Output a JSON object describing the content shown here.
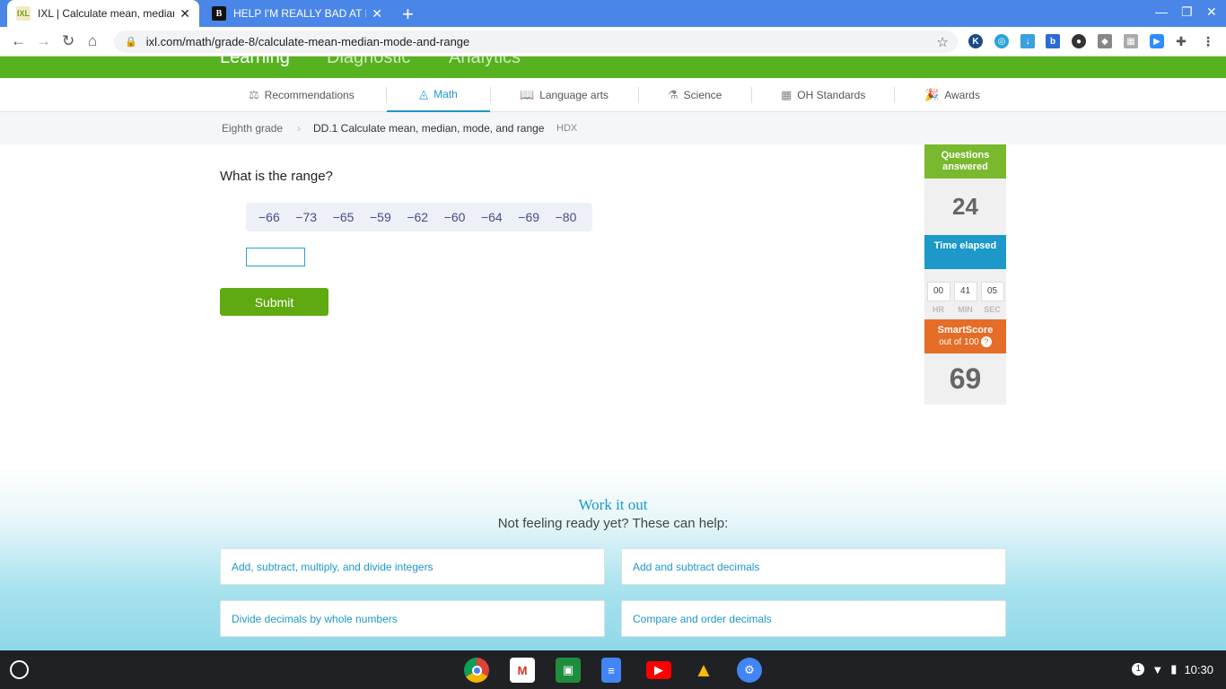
{
  "browser": {
    "tabs": [
      {
        "title": "IXL | Calculate mean, median, m",
        "favicon": "IXL",
        "active": true
      },
      {
        "title": "HELP I'M REALLY BAD AT MATH!",
        "favicon": "B",
        "active": false
      }
    ],
    "url": "ixl.com/math/grade-8/calculate-mean-median-mode-and-range"
  },
  "topnav": {
    "items": [
      "Learning",
      "Diagnostic",
      "Analytics"
    ]
  },
  "subnav": {
    "items": [
      {
        "label": "Recommendations",
        "icon": "recommendations-icon"
      },
      {
        "label": "Math",
        "icon": "math-icon",
        "active": true
      },
      {
        "label": "Language arts",
        "icon": "book-icon"
      },
      {
        "label": "Science",
        "icon": "science-icon"
      },
      {
        "label": "OH Standards",
        "icon": "standards-icon"
      },
      {
        "label": "Awards",
        "icon": "awards-icon"
      }
    ]
  },
  "breadcrumb": {
    "grade": "Eighth grade",
    "skill": "DD.1 Calculate mean, median, mode, and range",
    "code": "HDX"
  },
  "question": {
    "prompt": "What is the range?",
    "numbers": [
      "−66",
      "−73",
      "−65",
      "−59",
      "−62",
      "−60",
      "−64",
      "−69",
      "−80"
    ],
    "answer_value": "",
    "submit_label": "Submit"
  },
  "stats": {
    "questions_label": "Questions answered",
    "questions_value": "24",
    "time_label": "Time elapsed",
    "time": {
      "hr": "00",
      "min": "41",
      "sec": "05",
      "hr_label": "HR",
      "min_label": "MIN",
      "sec_label": "SEC"
    },
    "smartscore_label": "SmartScore",
    "smartscore_sub": "out of 100",
    "smartscore_help": "?",
    "smartscore_value": "69"
  },
  "work_it_out": {
    "title": "Work it out",
    "subtitle": "Not feeling ready yet? These can help:",
    "links": [
      "Add, subtract, multiply, and divide integers",
      "Add and subtract decimals",
      "Divide decimals by whole numbers",
      "Compare and order decimals"
    ]
  },
  "taskbar": {
    "time": "10:30",
    "notifications": "1"
  },
  "colors": {
    "ixl_green": "#56b31f",
    "ixl_blue": "#1c98c9",
    "ixl_orange": "#e46d27",
    "submit_green": "#5fa911"
  }
}
